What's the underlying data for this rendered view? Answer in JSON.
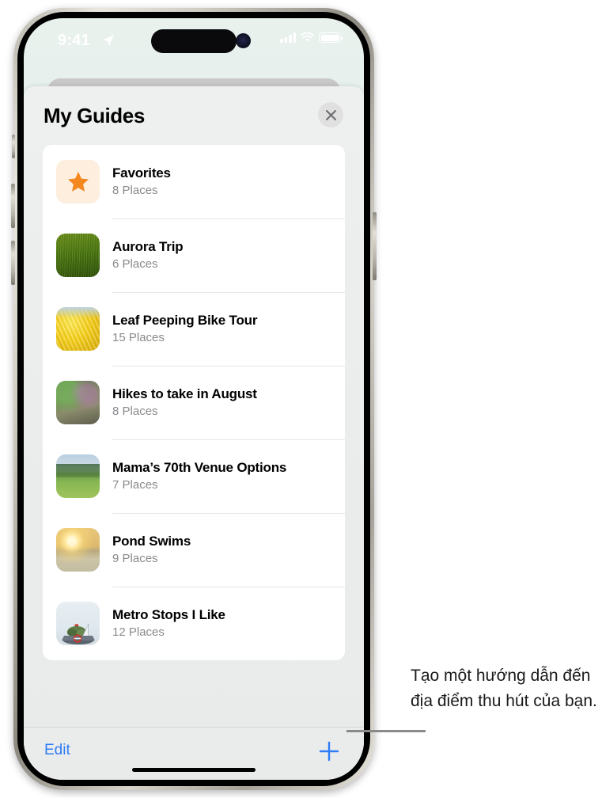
{
  "status_bar": {
    "time": "9:41",
    "location_icon": "location-arrow-icon",
    "cellular_icon": "cellular-signal-icon",
    "wifi_icon": "wifi-icon",
    "battery_icon": "battery-icon"
  },
  "sheet": {
    "title": "My Guides",
    "close_icon": "close-icon"
  },
  "guides": [
    {
      "title": "Favorites",
      "places": "8 Places",
      "thumb": "star-favorites-thumbnail"
    },
    {
      "title": "Aurora Trip",
      "places": "6 Places",
      "thumb": "grass-field-thumbnail"
    },
    {
      "title": "Leaf Peeping Bike Tour",
      "places": "15 Places",
      "thumb": "yellow-foliage-thumbnail"
    },
    {
      "title": "Hikes to take in August",
      "places": "8 Places",
      "thumb": "forest-trail-thumbnail"
    },
    {
      "title": "Mama’s 70th Venue Options",
      "places": "7 Places",
      "thumb": "meadow-clearing-thumbnail"
    },
    {
      "title": "Pond Swims",
      "places": "9 Places",
      "thumb": "sunset-pond-thumbnail"
    },
    {
      "title": "Metro Stops I Like",
      "places": "12 Places",
      "thumb": "ferry-boat-thumbnail"
    }
  ],
  "toolbar": {
    "edit_label": "Edit",
    "add_icon": "plus-icon"
  },
  "annotation": {
    "text": "Tạo một hướng dẫn đến địa điểm thu hút của bạn."
  },
  "colors": {
    "accent_blue": "#2f7cf6",
    "star_orange": "#f5871f",
    "subtitle_gray": "#8a8a8e",
    "sheet_bg": "#eaecec"
  }
}
